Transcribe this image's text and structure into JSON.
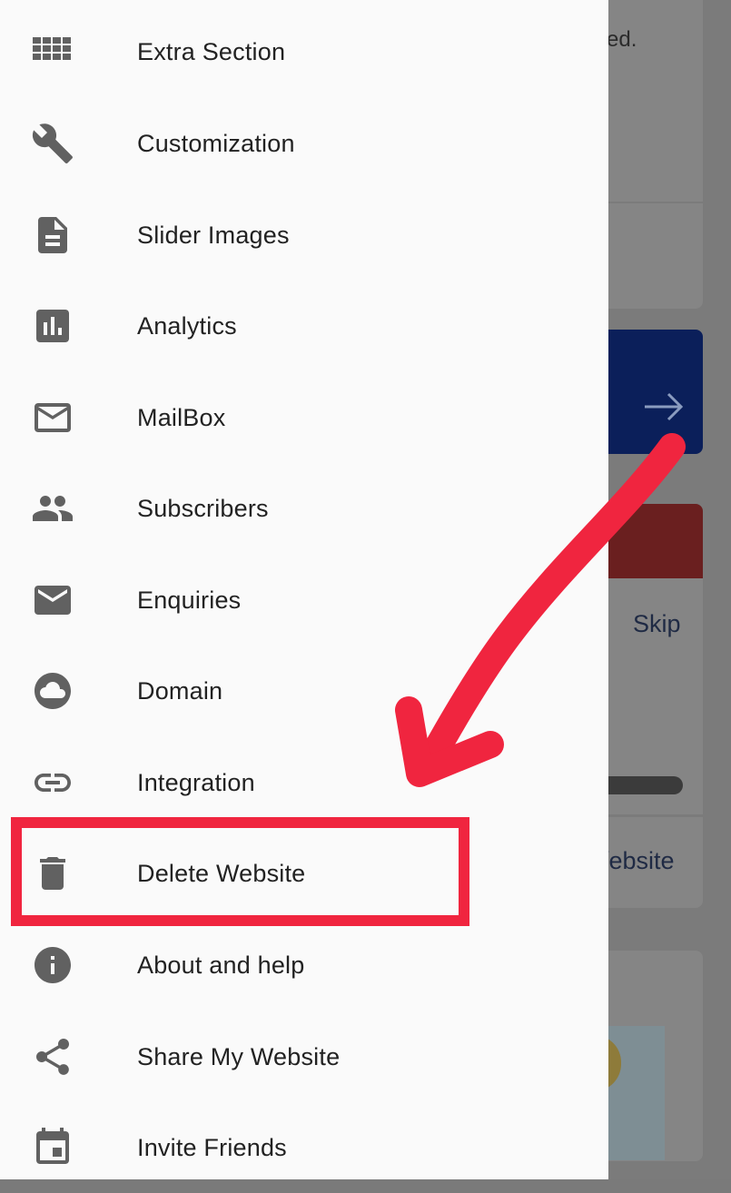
{
  "background": {
    "partial_text_top": "ed.",
    "skip_label": "Skip",
    "website_label": "/ebsite"
  },
  "drawer": {
    "items": [
      {
        "label": "Extra Section",
        "icon": "grid-icon"
      },
      {
        "label": "Customization",
        "icon": "wrench-icon"
      },
      {
        "label": "Slider Images",
        "icon": "document-icon"
      },
      {
        "label": "Analytics",
        "icon": "bar-chart-icon"
      },
      {
        "label": "MailBox",
        "icon": "mail-outline-icon"
      },
      {
        "label": "Subscribers",
        "icon": "people-icon"
      },
      {
        "label": "Enquiries",
        "icon": "mail-icon"
      },
      {
        "label": "Domain",
        "icon": "cloud-icon"
      },
      {
        "label": "Integration",
        "icon": "link-icon"
      },
      {
        "label": "Delete Website",
        "icon": "trash-icon"
      },
      {
        "label": "About and help",
        "icon": "info-icon"
      },
      {
        "label": "Share My Website",
        "icon": "share-icon"
      },
      {
        "label": "Invite Friends",
        "icon": "calendar-icon"
      }
    ]
  },
  "colors": {
    "drawer_bg": "#fafafa",
    "icon": "#616161",
    "annotation": "#f0253f",
    "scrim": "#7b7b7b"
  }
}
